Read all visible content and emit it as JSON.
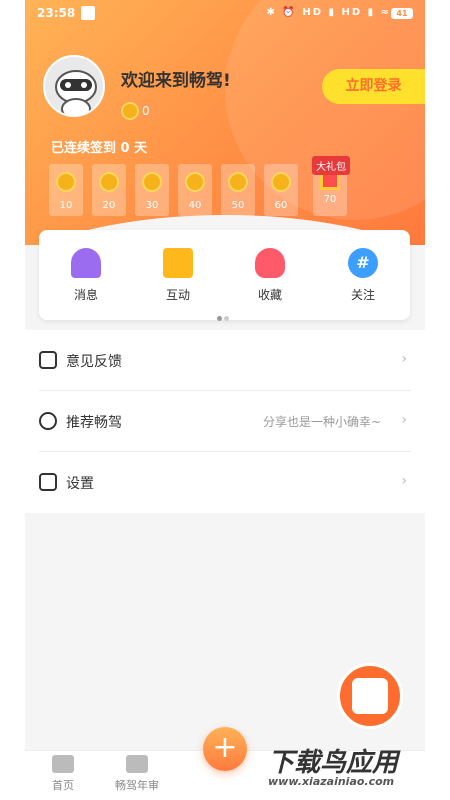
{
  "status": {
    "time": "23:58",
    "battery": "41",
    "icons": "✱ ⏰ HD ▮ HD ▮ ≈"
  },
  "profile": {
    "welcome": "欢迎来到畅驾!",
    "coins": "0",
    "login_label": "立即登录"
  },
  "checkin": {
    "streak_text": "已连续签到 0 天",
    "days": [
      "10",
      "20",
      "30",
      "40",
      "50",
      "60",
      "70"
    ],
    "gift_tag": "大礼包"
  },
  "quick": [
    {
      "label": "消息",
      "icon": "bell-icon"
    },
    {
      "label": "互动",
      "icon": "chat-bubble-icon"
    },
    {
      "label": "收藏",
      "icon": "heart-icon"
    },
    {
      "label": "关注",
      "icon": "hashtag-icon"
    }
  ],
  "menu": [
    {
      "label": "意见反馈",
      "hint": "",
      "icon": "feedback-icon"
    },
    {
      "label": "推荐畅驾",
      "hint": "分享也是一种小确幸~",
      "icon": "share-icon"
    },
    {
      "label": "设置",
      "hint": "",
      "icon": "settings-icon"
    }
  ],
  "tabs": [
    {
      "label": "首页",
      "icon": "home-icon"
    },
    {
      "label": "畅驾年审",
      "icon": "car-icon"
    }
  ],
  "fab_label": "+",
  "watermark": {
    "title": "下载鸟应用",
    "url": "www.xiazainiao.com"
  },
  "colors": {
    "accent": "#ff8f45",
    "login_bg": "#ffe02c"
  }
}
